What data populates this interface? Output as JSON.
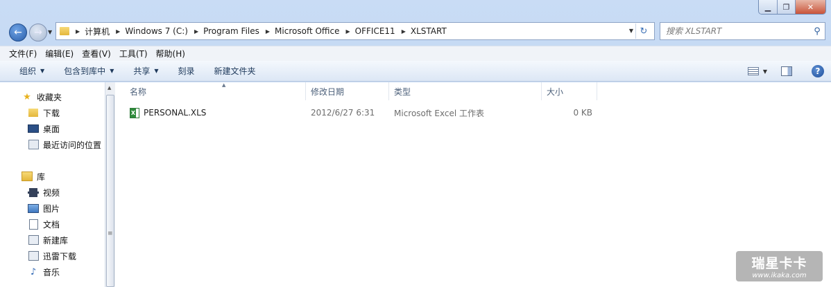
{
  "window": {
    "controls": {
      "minimize": "▁",
      "maximize": "❐",
      "close": "✕"
    }
  },
  "nav": {
    "back_icon": "←",
    "forward_icon": "→",
    "breadcrumbs": [
      "计算机",
      "Windows 7 (C:)",
      "Program Files",
      "Microsoft Office",
      "OFFICE11",
      "XLSTART"
    ],
    "refresh_icon": "↻"
  },
  "search": {
    "placeholder": "搜索 XLSTART",
    "icon": "⚲"
  },
  "menu": [
    "文件(F)",
    "编辑(E)",
    "查看(V)",
    "工具(T)",
    "帮助(H)"
  ],
  "toolbar": {
    "organize": "组织",
    "include_library": "包含到库中",
    "share": "共享",
    "burn": "刻录",
    "new_folder": "新建文件夹",
    "help_label": "?"
  },
  "sidebar": {
    "favorites": {
      "label": "收藏夹",
      "items": [
        "下载",
        "桌面",
        "最近访问的位置"
      ]
    },
    "libraries": {
      "label": "库",
      "items": [
        "视频",
        "图片",
        "文档",
        "新建库",
        "迅雷下载",
        "音乐"
      ]
    }
  },
  "columns": [
    "名称",
    "修改日期",
    "类型",
    "大小"
  ],
  "files": [
    {
      "name": "PERSONAL.XLS",
      "modified": "2012/6/27 6:31",
      "type": "Microsoft Excel 工作表",
      "size": "0 KB"
    }
  ],
  "watermark": {
    "main": "瑞星卡卡",
    "sub": "www.ikaka.com"
  },
  "colors": {
    "accent": "#2a5ea9",
    "chrome": "#c9dcf5",
    "excel_green": "#2e8b3b"
  }
}
